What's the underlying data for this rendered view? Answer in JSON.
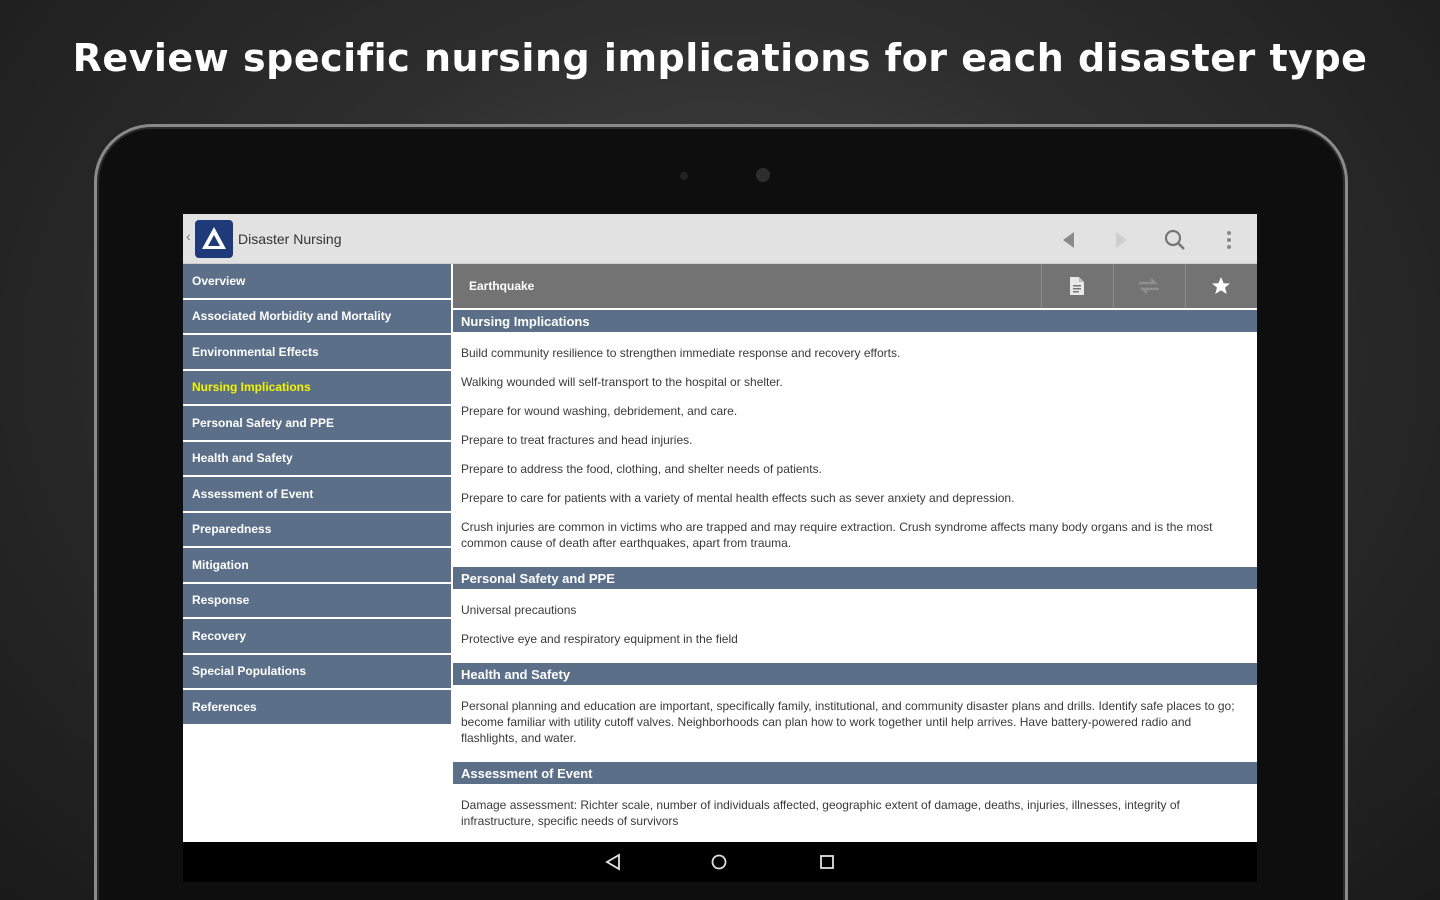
{
  "headline": "Review specific nursing implications for each disaster type",
  "app": {
    "title": "Disaster Nursing",
    "logo_icon": "warning-triangle-icon",
    "actions": [
      "previous-icon",
      "next-icon",
      "search-icon",
      "overflow-menu-icon"
    ]
  },
  "sidebar": {
    "items": [
      {
        "label": "Overview"
      },
      {
        "label": "Associated Morbidity and Mortality"
      },
      {
        "label": "Environmental Effects"
      },
      {
        "label": "Nursing Implications",
        "active": true
      },
      {
        "label": "Personal Safety and PPE"
      },
      {
        "label": "Health and Safety"
      },
      {
        "label": "Assessment of Event"
      },
      {
        "label": "Preparedness"
      },
      {
        "label": "Mitigation"
      },
      {
        "label": "Response"
      },
      {
        "label": "Recovery"
      },
      {
        "label": "Special Populations"
      },
      {
        "label": "References"
      }
    ]
  },
  "topic": {
    "title": "Earthquake",
    "buttons": [
      "document-icon",
      "swap-icon",
      "star-icon"
    ]
  },
  "sections": [
    {
      "header": "Nursing Implications",
      "items": [
        "Build community resilience to strengthen immediate response and recovery efforts.",
        "Walking wounded will self-transport to the hospital or shelter.",
        "Prepare for wound washing, debridement, and care.",
        "Prepare to treat fractures and head injuries.",
        "Prepare to address the food, clothing, and shelter needs of patients.",
        "Prepare to care for patients with a variety of mental health effects such as sever anxiety and depression.",
        "Crush injuries are common in victims who are trapped and may require extraction. Crush syndrome affects many body organs and is the most common cause of death after earthquakes, apart from trauma."
      ]
    },
    {
      "header": "Personal Safety and PPE",
      "items": [
        "Universal precautions",
        "Protective eye and respiratory equipment in the field"
      ]
    },
    {
      "header": "Health and Safety",
      "items": [
        "Personal planning and education are important, specifically family, institutional, and community disaster plans and drills. Identify safe places to go; become familiar with utility cutoff valves. Neighborhoods can plan how to work together until help arrives. Have battery-powered radio and flashlights, and water."
      ]
    },
    {
      "header": "Assessment of Event",
      "items": [
        "Damage assessment: Richter scale, number of individuals affected, geographic extent of damage, deaths, injuries, illnesses, integrity of infrastructure, specific needs of survivors"
      ]
    }
  ],
  "system_nav": [
    "back-icon",
    "home-icon",
    "recents-icon"
  ],
  "colors": {
    "nav_blue": "#5b6f89",
    "active_text": "#f5f500",
    "topic_bar": "#737373",
    "logo_blue": "#1f3a78"
  }
}
